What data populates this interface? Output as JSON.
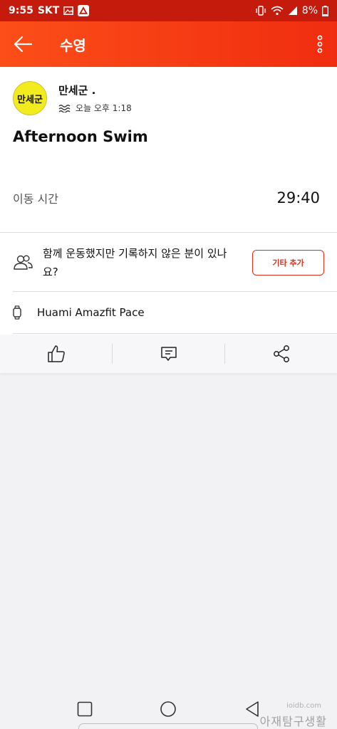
{
  "status_bar": {
    "time": "9:55",
    "carrier": "SKT",
    "battery": "8%",
    "background_color": "#c51b0d"
  },
  "app_bar": {
    "title": "수영",
    "accent_color": "#fc4e18"
  },
  "author": {
    "avatar_text": "만세군",
    "name": "만세군 .",
    "time": "오늘 오후 1:18",
    "activity_icon": "swim-icon"
  },
  "activity": {
    "title": "Afternoon Swim"
  },
  "stats": {
    "moving_time_label": "이동 시간",
    "moving_time_value": "29:40"
  },
  "invite": {
    "text": "함께 운동했지만 기록하지 않은 분이 있나요?",
    "button_label": "기타 추가",
    "button_color": "#e0301b"
  },
  "device": {
    "name": "Huami Amazfit Pace"
  },
  "actions": [
    "thumbs-up-icon",
    "comment-icon",
    "share-icon"
  ],
  "watermark": {
    "site": "ioidb.com",
    "text": "아재탐구생활"
  }
}
